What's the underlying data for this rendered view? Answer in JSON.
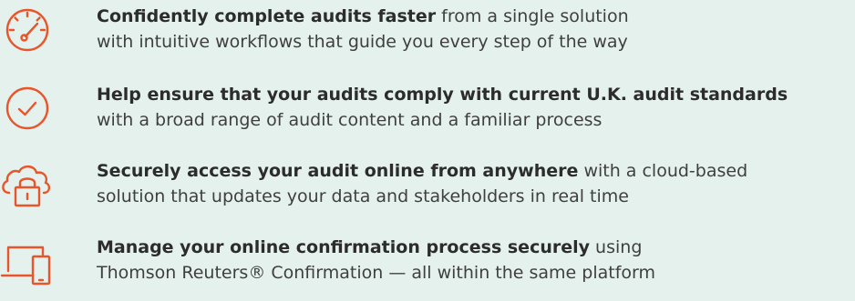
{
  "colors": {
    "background": "#e5f1ed",
    "icon_accent": "#e8552b",
    "text": "#3f3f3f"
  },
  "features": [
    {
      "icon": "speedometer-icon",
      "bold": "Confidently complete audits faster",
      "rest_line1": " from a single solution",
      "line2": "with intuitive workflows that guide you every step of the way"
    },
    {
      "icon": "check-circle-icon",
      "bold": "Help ensure that your audits comply with current U.K. audit standards",
      "rest_line1": "",
      "line2": "with a broad range of audit content and a familiar process"
    },
    {
      "icon": "cloud-lock-icon",
      "bold": "Securely access your audit online from anywhere",
      "rest_line1": " with a cloud-based",
      "line2": "solution that updates your data and stakeholders in real time"
    },
    {
      "icon": "devices-icon",
      "bold": "Manage your online confirmation process securely",
      "rest_line1": " using",
      "line2": "Thomson Reuters® Confirmation — all within the same platform"
    }
  ]
}
